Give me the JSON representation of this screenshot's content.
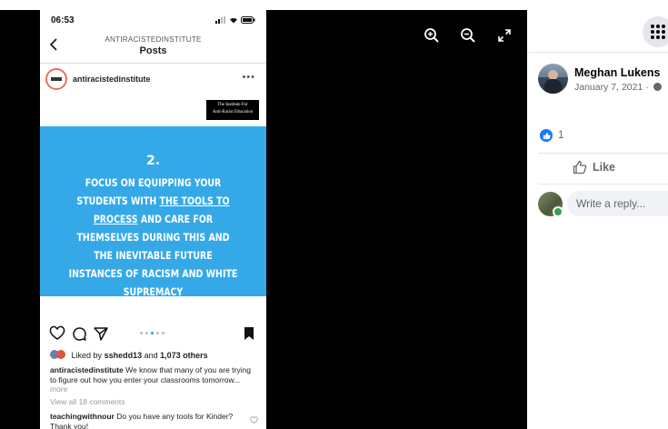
{
  "phone": {
    "status_time": "06:53",
    "header_subtitle": "ANTIRACISTEDINSTITUTE",
    "header_title": "Posts",
    "account_name": "antiracistedinstitute",
    "more_glyph": "•••",
    "badge_line1": "The Institute For",
    "badge_line2": "Anti-Racist Education",
    "post_number": "2.",
    "post_text_a": "Focus on equipping your students with",
    "post_text_u": "the tools to process",
    "post_text_b": "and care for themselves during this and the inevitable future instances of racism and white supremacy",
    "likes_prefix": "Liked by",
    "likes_user": "sshedd13",
    "likes_and": "and",
    "likes_count": "1,073 others",
    "caption_user": "antiracistedinstitute",
    "caption_text": "We know that many of you are trying to figure out how you enter your classrooms tomorrow...",
    "caption_more": "more",
    "view_all": "View all 18 comments",
    "comment_user": "teachingwithnour",
    "comment_text": "Do you have any tools for Kinder? Thank you!",
    "carousel_active_index": 2
  },
  "panel": {
    "author_name": "Meghan Lukens",
    "author_date": "January 7, 2021 ·",
    "reaction_count": "1",
    "like_label": "Like",
    "reply_placeholder": "Write a reply..."
  },
  "icons": {
    "zoom_in": "zoom-in-icon",
    "zoom_out": "zoom-out-icon",
    "fullscreen": "fullscreen-icon",
    "menu": "menu-grid-icon",
    "globe": "globe-icon"
  },
  "colors": {
    "post_blue": "#35a9e8",
    "fb_blue": "#1877f2",
    "online_green": "#31a24c"
  }
}
